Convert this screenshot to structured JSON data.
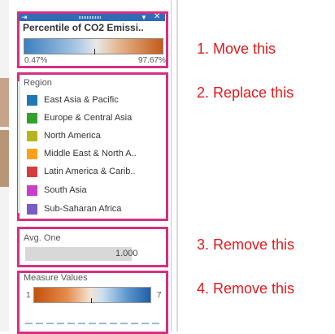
{
  "card1": {
    "title": "Percentile of CO2 Emissi..",
    "min_label": "0.47%",
    "max_label": "97.67%",
    "pin_icon": "pin-icon",
    "dropdown_icon": "dropdown-arrow-icon",
    "close_icon": "close-icon"
  },
  "card2": {
    "title": "Region",
    "items": [
      {
        "label": "East Asia & Pacific",
        "color": "#1f78b4"
      },
      {
        "label": "Europe & Central Asia",
        "color": "#33a02c"
      },
      {
        "label": "North America",
        "color": "#b5b520"
      },
      {
        "label": "Middle East & North A..",
        "color": "#ff9f1c"
      },
      {
        "label": "Latin America & Carib..",
        "color": "#d73d3d"
      },
      {
        "label": "South Asia",
        "color": "#c93fc9"
      },
      {
        "label": "Sub-Saharan Africa",
        "color": "#7a5cc8"
      }
    ]
  },
  "card3": {
    "title": "Avg. One",
    "value": "1.000"
  },
  "card4": {
    "title": "Measure Values",
    "min_label": "1",
    "max_label": "7"
  },
  "annotations": [
    "1. Move this",
    "2. Replace this",
    "3. Remove this",
    "4. Remove this"
  ],
  "colors": {
    "frame": "#d62f84",
    "annotation_text": "#e0191b",
    "title_bar": "#2f6cb5"
  }
}
